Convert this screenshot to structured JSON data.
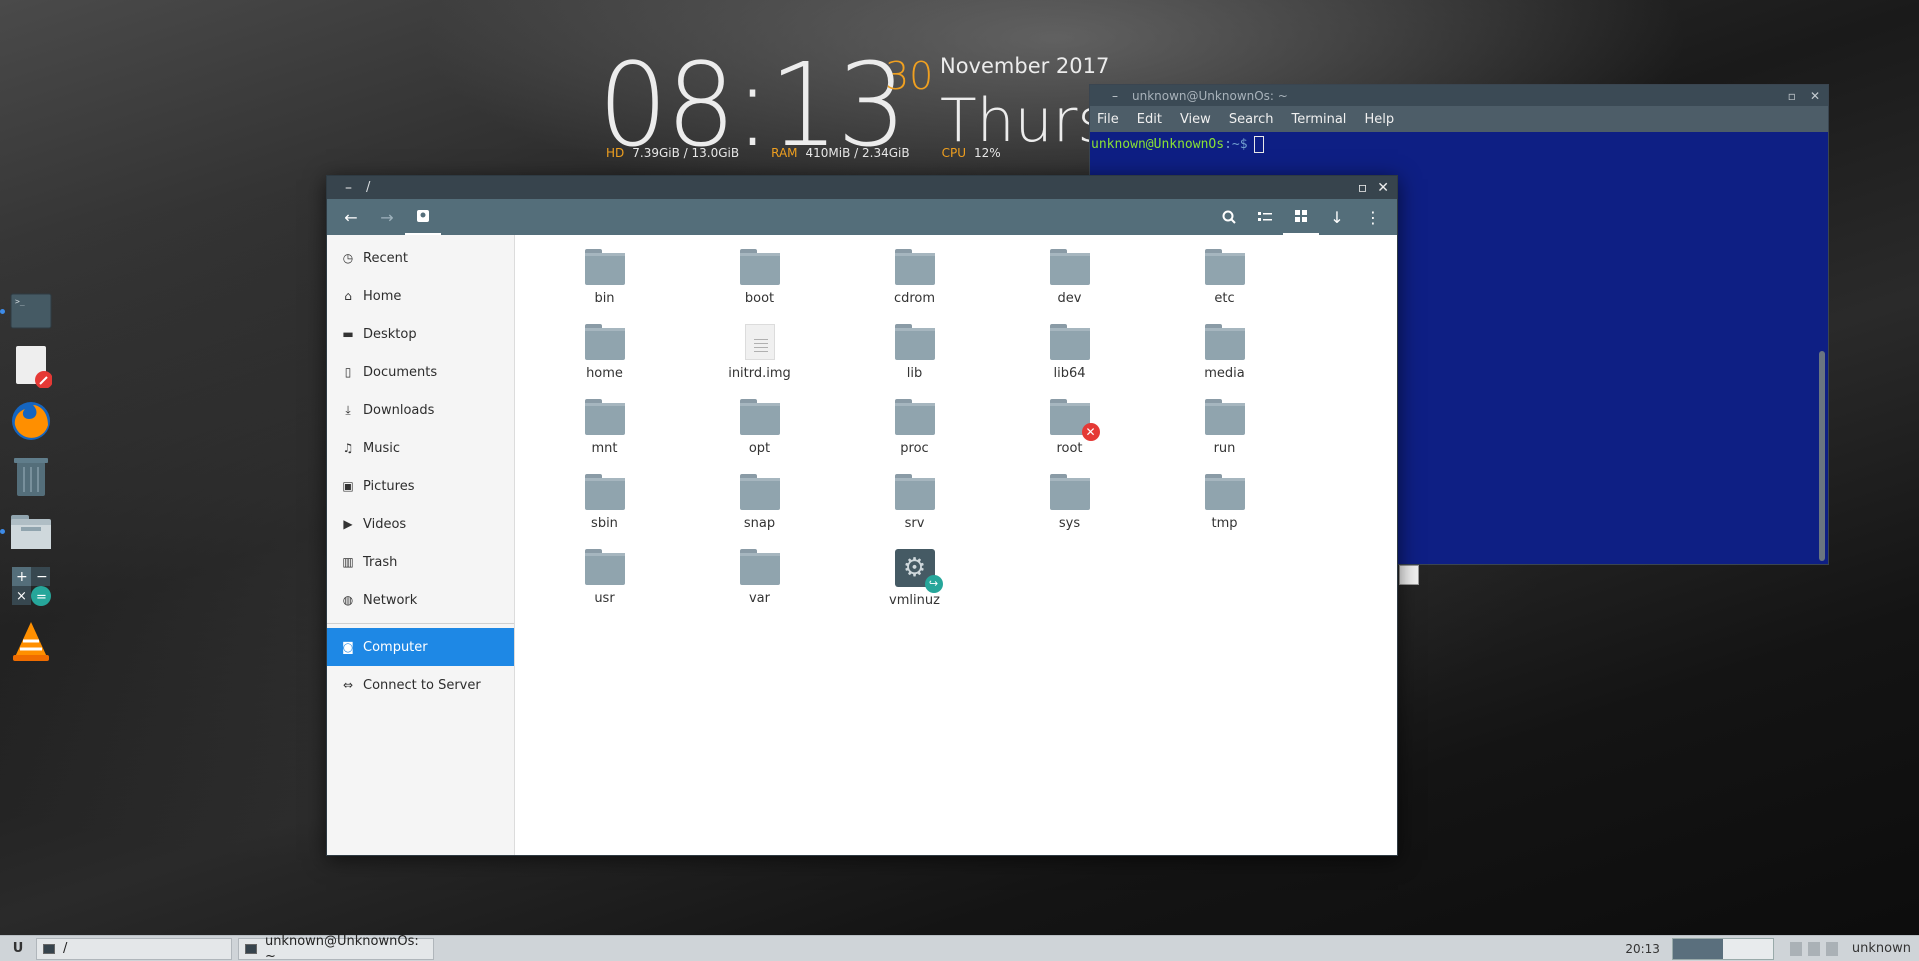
{
  "conky": {
    "time": "08:13",
    "day": "30",
    "month_year": "November 2017",
    "weekday": "Thursday",
    "hd_label": "HD",
    "hd_value": "7.39GiB / 13.0GiB",
    "ram_label": "RAM",
    "ram_value": "410MiB / 2.34GiB",
    "cpu_label": "CPU",
    "cpu_value": "12%"
  },
  "dock": {
    "items": [
      "terminal-icon",
      "text-editor-icon",
      "firefox-icon",
      "trash-icon",
      "files-icon",
      "calculator-icon",
      "vlc-icon"
    ]
  },
  "terminal": {
    "title": "unknown@UnknownOs: ~",
    "menu": [
      "File",
      "Edit",
      "View",
      "Search",
      "Terminal",
      "Help"
    ],
    "prompt_user": "unknown@UnknownOs",
    "prompt_path": ":~$"
  },
  "filemanager": {
    "title": "/",
    "sidebar": [
      {
        "label": "Recent",
        "icon": "clock-icon"
      },
      {
        "label": "Home",
        "icon": "home-icon"
      },
      {
        "label": "Desktop",
        "icon": "desktop-icon"
      },
      {
        "label": "Documents",
        "icon": "document-icon"
      },
      {
        "label": "Downloads",
        "icon": "download-icon"
      },
      {
        "label": "Music",
        "icon": "music-icon"
      },
      {
        "label": "Pictures",
        "icon": "picture-icon"
      },
      {
        "label": "Videos",
        "icon": "video-icon"
      },
      {
        "label": "Trash",
        "icon": "trash-icon"
      },
      {
        "label": "Network",
        "icon": "network-icon"
      }
    ],
    "sidebar_bottom": [
      {
        "label": "Computer",
        "icon": "computer-icon",
        "selected": true
      },
      {
        "label": "Connect to Server",
        "icon": "connect-icon"
      }
    ],
    "files": [
      {
        "name": "bin",
        "type": "folder"
      },
      {
        "name": "boot",
        "type": "folder"
      },
      {
        "name": "cdrom",
        "type": "folder"
      },
      {
        "name": "dev",
        "type": "folder"
      },
      {
        "name": "etc",
        "type": "folder"
      },
      {
        "name": "home",
        "type": "folder"
      },
      {
        "name": "initrd.img",
        "type": "file"
      },
      {
        "name": "lib",
        "type": "folder"
      },
      {
        "name": "lib64",
        "type": "folder"
      },
      {
        "name": "media",
        "type": "folder"
      },
      {
        "name": "mnt",
        "type": "folder"
      },
      {
        "name": "opt",
        "type": "folder"
      },
      {
        "name": "proc",
        "type": "folder"
      },
      {
        "name": "root",
        "type": "folder-locked"
      },
      {
        "name": "run",
        "type": "folder"
      },
      {
        "name": "sbin",
        "type": "folder"
      },
      {
        "name": "snap",
        "type": "folder"
      },
      {
        "name": "srv",
        "type": "folder"
      },
      {
        "name": "sys",
        "type": "folder"
      },
      {
        "name": "tmp",
        "type": "folder"
      },
      {
        "name": "usr",
        "type": "folder"
      },
      {
        "name": "var",
        "type": "folder"
      },
      {
        "name": "vmlinuz",
        "type": "executable-link"
      }
    ]
  },
  "taskbar": {
    "start": "U",
    "tasks": [
      "/",
      "unknown@UnknownOs: ~"
    ],
    "clock": "20:13",
    "user": "unknown"
  }
}
